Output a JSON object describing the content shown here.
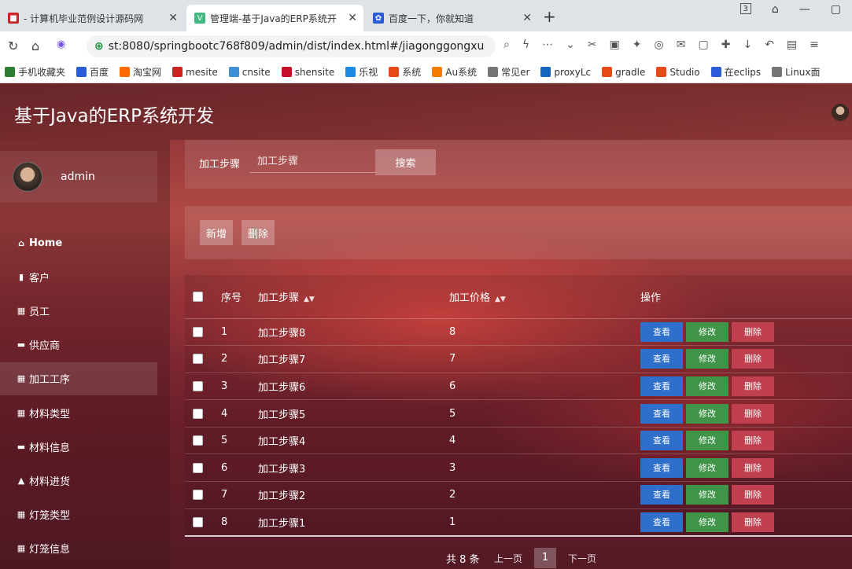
{
  "browser": {
    "tabs": [
      {
        "title": "- 计算机毕业范例设计源码网",
        "active": false,
        "icon": "red-flag-icon"
      },
      {
        "title": "管理端-基于Java的ERP系统开",
        "active": true,
        "icon": "vue-icon"
      },
      {
        "title": "百度一下，你就知道",
        "active": false,
        "icon": "baidu-paw-icon"
      }
    ],
    "tab_counter": "3",
    "url": "st:8080/springbootc768f809/admin/dist/index.html#/jiagonggongxu",
    "bookmarks": [
      {
        "label": "手机收藏夹",
        "color": "#2d7d32"
      },
      {
        "label": "百度",
        "color": "#2b5bd7"
      },
      {
        "label": "淘宝网",
        "color": "#ff6a00"
      },
      {
        "label": "mesite",
        "color": "#d02020"
      },
      {
        "label": "cnsite",
        "color": "#3c8fd4"
      },
      {
        "label": "shensite",
        "color": "#c8102e"
      },
      {
        "label": "乐视",
        "color": "#1e88e5"
      },
      {
        "label": "系统",
        "color": "#e64a19"
      },
      {
        "label": "Au系统",
        "color": "#f57c00"
      },
      {
        "label": "常见er",
        "color": "#757575"
      },
      {
        "label": "proxyLc",
        "color": "#1565c0"
      },
      {
        "label": "gradle",
        "color": "#e64a19"
      },
      {
        "label": "Studio",
        "color": "#e64a19"
      },
      {
        "label": "在eclips",
        "color": "#2b5bd7"
      },
      {
        "label": "Linux面",
        "color": "#757575"
      }
    ]
  },
  "app": {
    "title": "基于Java的ERP系统开发",
    "user": {
      "name": "admin"
    },
    "menu": [
      {
        "label": "Home",
        "icon": "home-icon",
        "glyph": "⌂"
      },
      {
        "label": "客户",
        "icon": "bar-chart-icon",
        "glyph": "▮"
      },
      {
        "label": "员工",
        "icon": "grid-icon",
        "glyph": "▦"
      },
      {
        "label": "供应商",
        "icon": "comment-icon",
        "glyph": "▬"
      },
      {
        "label": "加工工序",
        "icon": "grid-icon",
        "glyph": "▦"
      },
      {
        "label": "材料类型",
        "icon": "grid-icon",
        "glyph": "▦"
      },
      {
        "label": "材料信息",
        "icon": "comment-icon",
        "glyph": "▬"
      },
      {
        "label": "材料进货",
        "icon": "user-icon",
        "glyph": "▲"
      },
      {
        "label": "灯笼类型",
        "icon": "grid-icon",
        "glyph": "▦"
      },
      {
        "label": "灯笼信息",
        "icon": "grid-icon",
        "glyph": "▦"
      }
    ],
    "active_menu": "加工工序",
    "search": {
      "label": "加工步骤",
      "placeholder": "加工步骤",
      "button": "搜索"
    },
    "actions": {
      "add": "新增",
      "delete": "删除"
    },
    "table": {
      "headers": {
        "index": "序号",
        "step": "加工步骤",
        "price": "加工价格",
        "ops": "操作"
      },
      "rows": [
        {
          "index": "1",
          "step": "加工步骤8",
          "price": "8"
        },
        {
          "index": "2",
          "step": "加工步骤7",
          "price": "7"
        },
        {
          "index": "3",
          "step": "加工步骤6",
          "price": "6"
        },
        {
          "index": "4",
          "step": "加工步骤5",
          "price": "5"
        },
        {
          "index": "5",
          "step": "加工步骤4",
          "price": "4"
        },
        {
          "index": "6",
          "step": "加工步骤3",
          "price": "3"
        },
        {
          "index": "7",
          "step": "加工步骤2",
          "price": "2"
        },
        {
          "index": "8",
          "step": "加工步骤1",
          "price": "1"
        }
      ],
      "op_labels": {
        "view": "查看",
        "edit": "修改",
        "delete": "删除"
      }
    },
    "pagination": {
      "total": "共 8 条",
      "prev": "上一页",
      "current": "1",
      "next": "下一页"
    }
  }
}
